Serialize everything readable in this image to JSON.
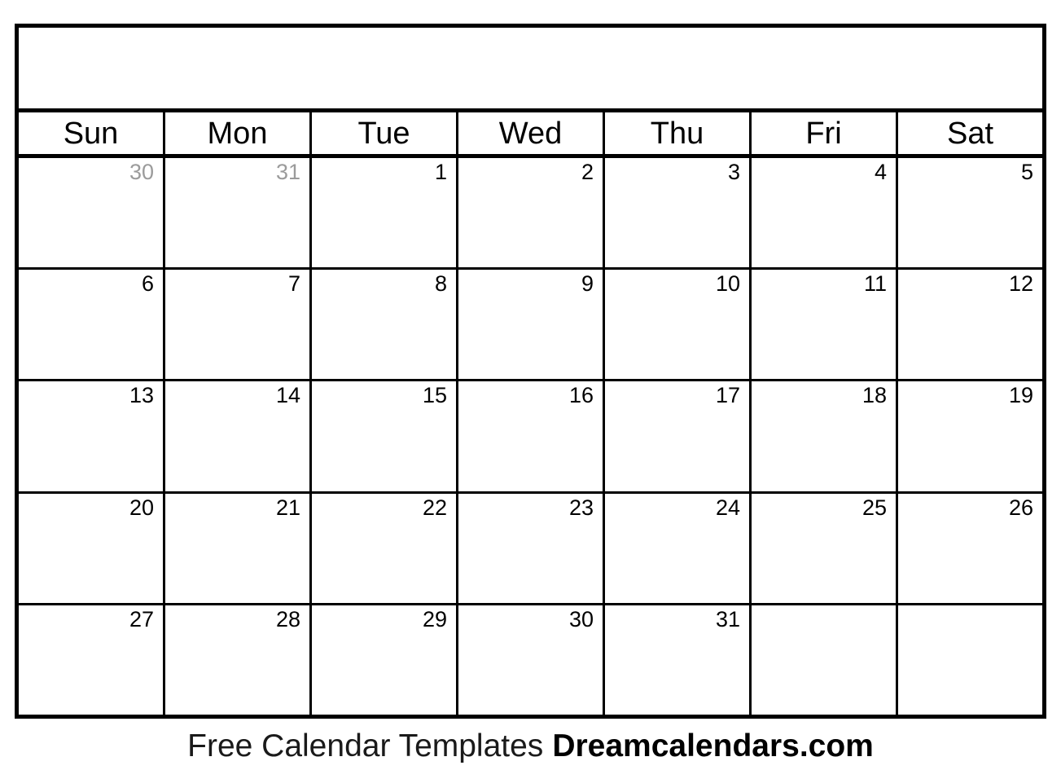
{
  "document": {
    "type": "blank-monthly-calendar",
    "title": "",
    "colors": {
      "border": "#000000",
      "text": "#000000",
      "muted_text": "#9b9b9b",
      "background": "#ffffff"
    }
  },
  "header": {
    "weekdays": [
      "Sun",
      "Mon",
      "Tue",
      "Wed",
      "Thu",
      "Fri",
      "Sat"
    ]
  },
  "weeks": [
    [
      {
        "label": "30",
        "muted": true
      },
      {
        "label": "31",
        "muted": true
      },
      {
        "label": "1",
        "muted": false
      },
      {
        "label": "2",
        "muted": false
      },
      {
        "label": "3",
        "muted": false
      },
      {
        "label": "4",
        "muted": false
      },
      {
        "label": "5",
        "muted": false
      }
    ],
    [
      {
        "label": "6",
        "muted": false
      },
      {
        "label": "7",
        "muted": false
      },
      {
        "label": "8",
        "muted": false
      },
      {
        "label": "9",
        "muted": false
      },
      {
        "label": "10",
        "muted": false
      },
      {
        "label": "11",
        "muted": false
      },
      {
        "label": "12",
        "muted": false
      }
    ],
    [
      {
        "label": "13",
        "muted": false
      },
      {
        "label": "14",
        "muted": false
      },
      {
        "label": "15",
        "muted": false
      },
      {
        "label": "16",
        "muted": false
      },
      {
        "label": "17",
        "muted": false
      },
      {
        "label": "18",
        "muted": false
      },
      {
        "label": "19",
        "muted": false
      }
    ],
    [
      {
        "label": "20",
        "muted": false
      },
      {
        "label": "21",
        "muted": false
      },
      {
        "label": "22",
        "muted": false
      },
      {
        "label": "23",
        "muted": false
      },
      {
        "label": "24",
        "muted": false
      },
      {
        "label": "25",
        "muted": false
      },
      {
        "label": "26",
        "muted": false
      }
    ],
    [
      {
        "label": "27",
        "muted": false
      },
      {
        "label": "28",
        "muted": false
      },
      {
        "label": "29",
        "muted": false
      },
      {
        "label": "30",
        "muted": false
      },
      {
        "label": "31",
        "muted": false
      },
      {
        "label": "",
        "muted": false
      },
      {
        "label": "",
        "muted": false
      }
    ]
  ],
  "footer": {
    "regular_text": "Free Calendar Templates",
    "bold_text": "Dreamcalendars.com"
  }
}
